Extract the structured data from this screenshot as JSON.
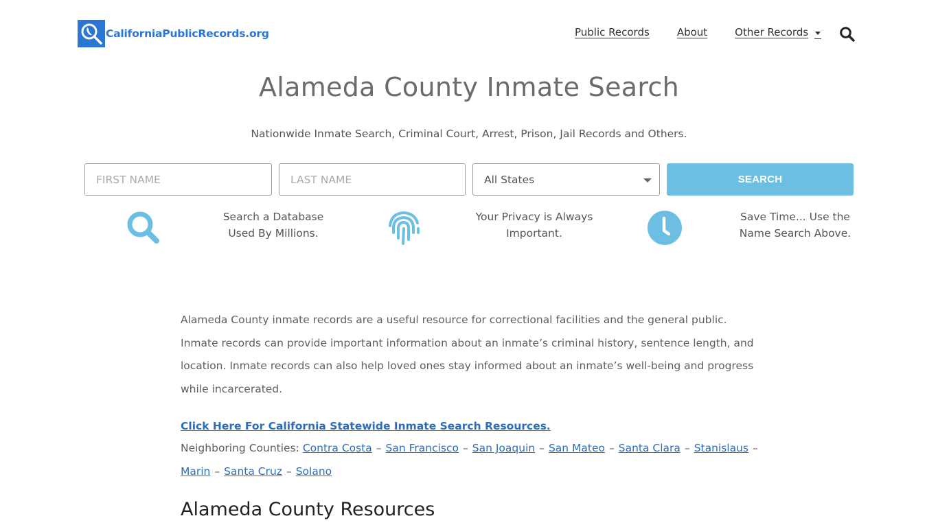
{
  "header": {
    "logo_text": "CaliforniaPublicRecords.org",
    "brand_color": "#2a76d2",
    "nav": [
      {
        "label": "Public Records"
      },
      {
        "label": "About"
      },
      {
        "label": "Other Records",
        "has_dropdown": true
      }
    ],
    "search_icon": "search-icon"
  },
  "hero": {
    "title": "Alameda County Inmate Search",
    "subtitle": "Nationwide Inmate Search, Criminal Court, Arrest, Prison, Jail Records and Others."
  },
  "search_form": {
    "first_name_placeholder": "FIRST NAME",
    "first_name_value": "",
    "last_name_placeholder": "LAST NAME",
    "last_name_value": "",
    "state_selected": "All States",
    "button_label": "SEARCH",
    "accent_color": "#6cbee3"
  },
  "features": [
    {
      "icon": "magnifier-icon",
      "line1": "Search a Database",
      "line2": "Used By Millions."
    },
    {
      "icon": "fingerprint-icon",
      "line1": "Your Privacy is Always",
      "line2": "Important."
    },
    {
      "icon": "clock-icon",
      "line1": "Save Time... Use the",
      "line2": "Name Search Above."
    }
  ],
  "content": {
    "paragraph": "Alameda County inmate records are a useful resource for correctional facilities and the general public. Inmate records can provide important information about an inmate’s criminal history, sentence length, and location. Inmate records can also help loved ones stay informed about an inmate’s well-being and progress while incarcerated.",
    "statewide_link": "Click Here For California Statewide Inmate Search Resources.",
    "neighbors_label": "Neighboring Counties:",
    "neighbors_separator": "–",
    "neighbors": [
      "Contra Costa",
      "San Francisco",
      "San Joaquin",
      "San Mateo",
      "Santa Clara",
      "Stanislaus",
      "Marin",
      "Santa Cruz",
      "Solano"
    ],
    "link_color": "#2a6fbf",
    "section_title": "Alameda County Resources"
  }
}
